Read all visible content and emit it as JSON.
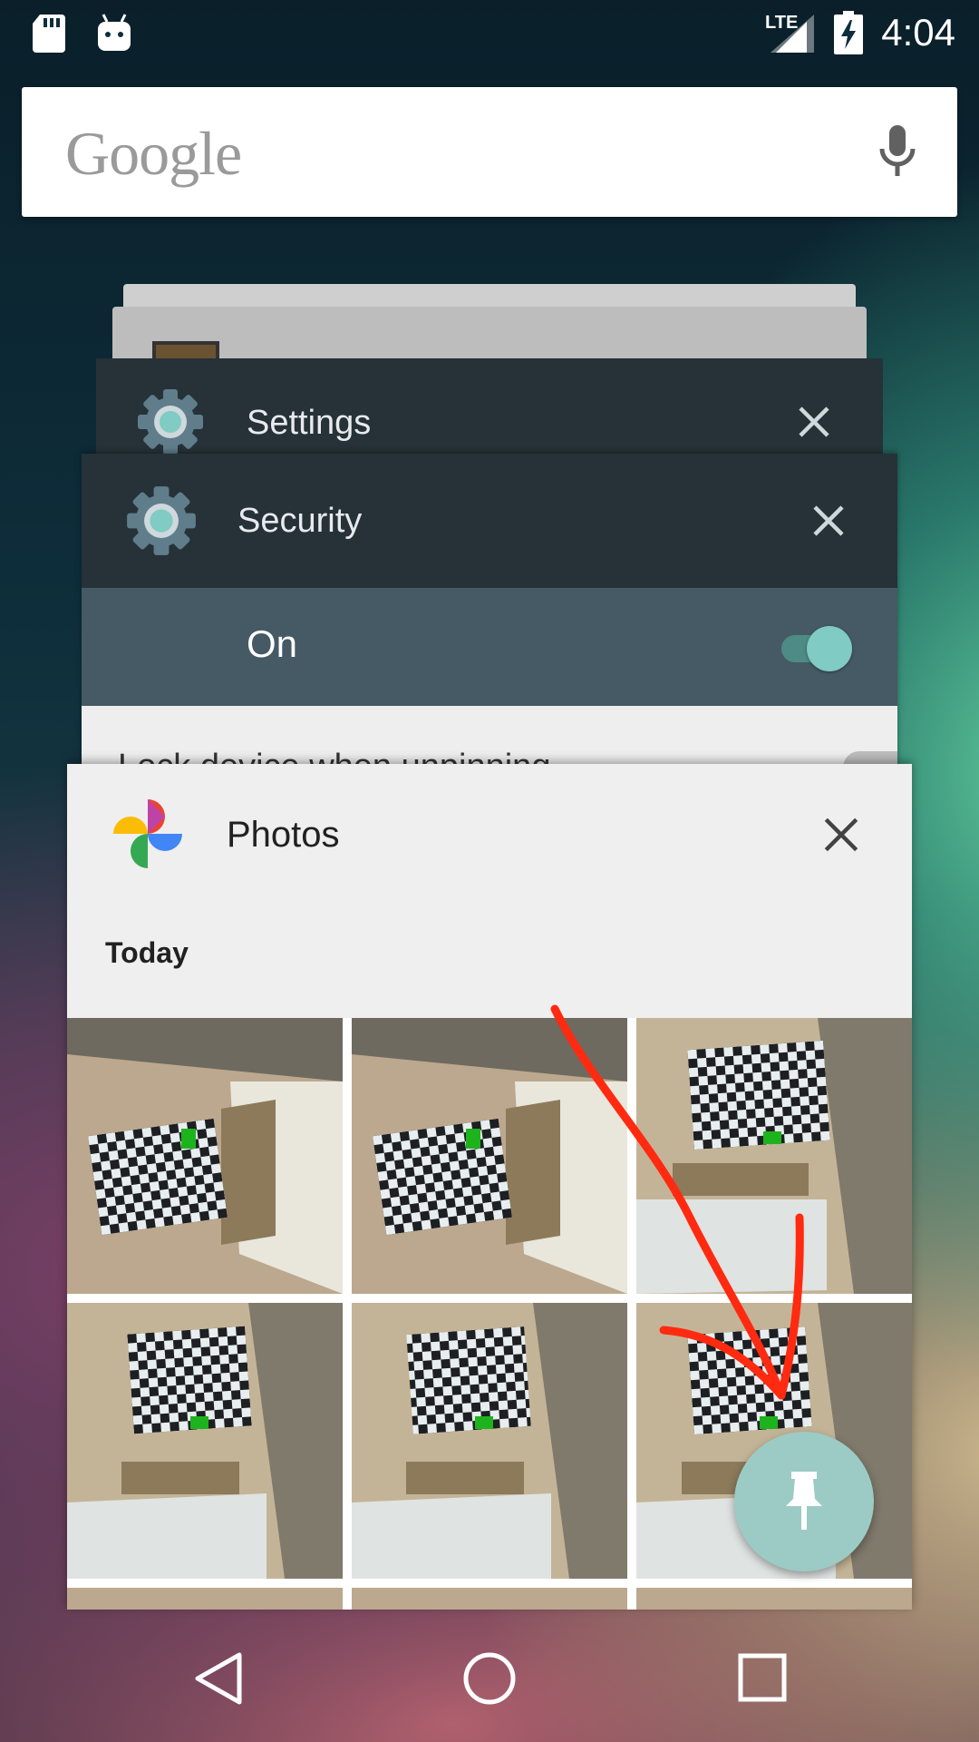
{
  "status_bar": {
    "network": "LTE",
    "time": "4:04"
  },
  "search": {
    "logo_text": "Google",
    "mic_icon": "mic-icon"
  },
  "recent_apps": {
    "cards": [
      {
        "title": "Settings",
        "icon": "settings-gear-icon"
      },
      {
        "title": "Security",
        "icon": "settings-gear-icon",
        "row_label": "On",
        "toggle_on": true,
        "next_row_label": "Lock device when unpinning"
      },
      {
        "title": "Photos",
        "icon": "google-photos-pinwheel-icon",
        "section_label": "Today"
      }
    ],
    "pin_icon": "pin-icon"
  },
  "nav": {
    "back_icon": "back-triangle-icon",
    "home_icon": "home-circle-icon",
    "recents_icon": "recents-square-icon"
  },
  "colors": {
    "card_header_dark": "#263238",
    "security_row": "#455a64",
    "accent_teal": "#80cbc4",
    "annotation_red": "#ff2a10"
  }
}
